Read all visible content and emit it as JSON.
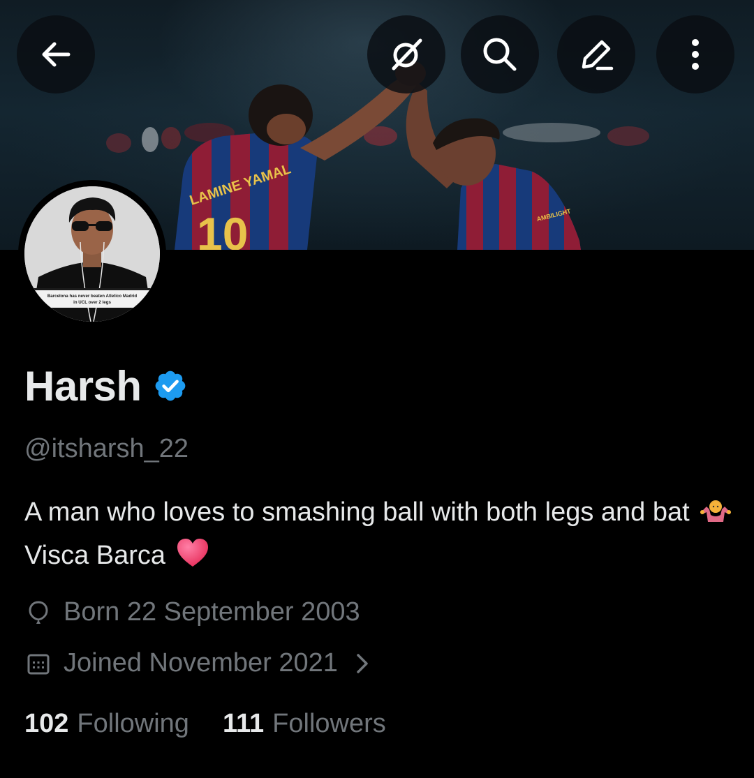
{
  "header": {
    "back_icon": "arrow-left-icon",
    "actions": [
      "grok-icon",
      "search-icon",
      "edit-icon",
      "more-vertical-icon"
    ]
  },
  "banner": {
    "jersey_name": "LAMINE YAMAL",
    "jersey_number": "10",
    "sleeve_text": "AMBILIGHT"
  },
  "avatar": {
    "caption_line1": "Barcelona has never beaten Atletico Madrid",
    "caption_line2": "in UCL over 2 legs"
  },
  "profile": {
    "name": "Harsh",
    "verified_color": "#1d9bf0",
    "handle": "@itsharsh_22",
    "bio_part1": "A man who loves to smashing ball with both legs and bat",
    "bio_part2": "Visca Barca",
    "birth": "Born 22 September 2003",
    "joined": "Joined November 2021",
    "following_count": "102",
    "following_label": "Following",
    "followers_count": "111",
    "followers_label": "Followers"
  },
  "colors": {
    "background": "#000000",
    "text_primary": "#e7e9ea",
    "text_secondary": "#71767b"
  }
}
